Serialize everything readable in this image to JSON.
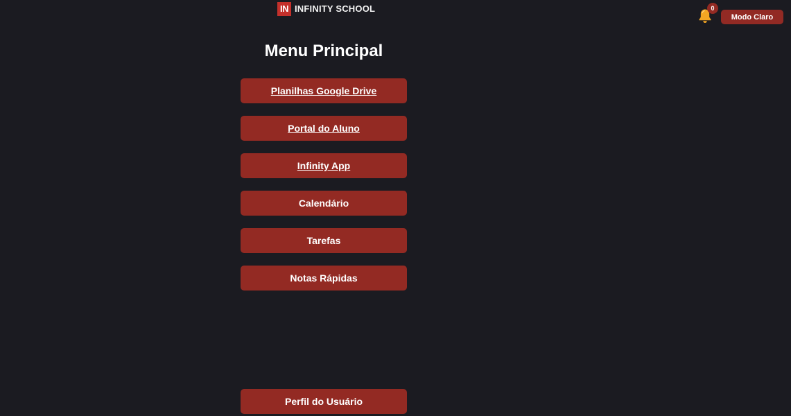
{
  "header": {
    "logo_mark": "IN",
    "logo_text": "INFINITY SCHOOL",
    "notification_count": "0",
    "mode_button": "Modo Claro",
    "icons": {
      "notifications": "bell-icon"
    }
  },
  "main": {
    "title": "Menu Principal",
    "menu": [
      {
        "label": "Planilhas Google Drive"
      },
      {
        "label": "Portal do Aluno"
      },
      {
        "label": "Infinity App"
      },
      {
        "label": "Calendário"
      },
      {
        "label": "Tarefas"
      },
      {
        "label": "Notas Rápidas"
      }
    ],
    "profile_button": "Perfil do Usuário"
  },
  "colors": {
    "background": "#1b1b21",
    "button": "#932a23",
    "logo_red": "#c4302b",
    "bell": "#f5a623"
  }
}
